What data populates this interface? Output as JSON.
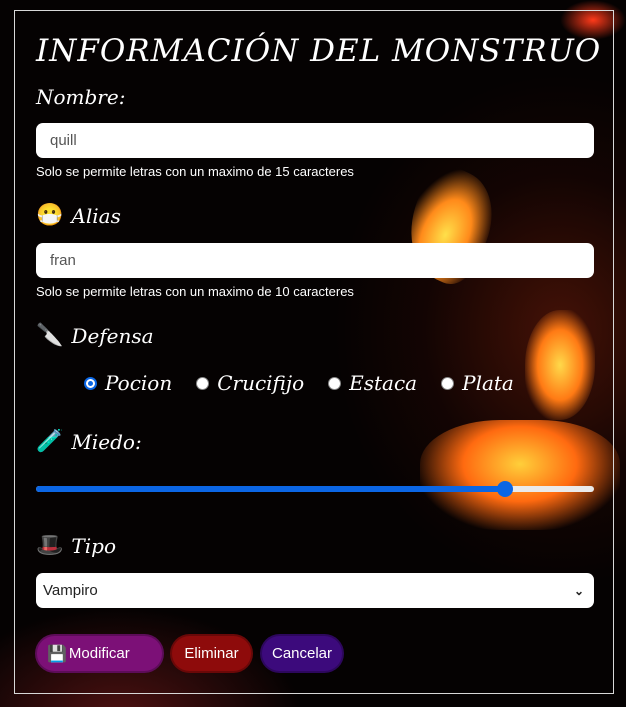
{
  "form": {
    "title": "Información del monstruo",
    "nombre": {
      "label": "Nombre:",
      "value": "quill",
      "hint": "Solo se permite letras con un maximo de 15 caracteres"
    },
    "alias": {
      "icon": "hockey-mask-icon",
      "icon_glyph": "🥽",
      "label": "Alias",
      "value": "fran",
      "hint": "Solo se permite letras con un maximo de 10 caracteres"
    },
    "defensa": {
      "icon": "cleaver-icon",
      "icon_glyph": "🔪",
      "label": "Defensa",
      "options": [
        {
          "label": "Pocion",
          "checked": true
        },
        {
          "label": "Crucifijo",
          "checked": false
        },
        {
          "label": "Estaca",
          "checked": false
        },
        {
          "label": "Plata",
          "checked": false
        }
      ]
    },
    "miedo": {
      "icon": "potion-icon",
      "icon_glyph": "🧪",
      "label": "Miedo:",
      "level": 0.84
    },
    "tipo": {
      "icon": "witch-hat-icon",
      "icon_glyph": "🧙",
      "label": "Tipo",
      "selected": "Vampiro"
    },
    "buttons": {
      "modificar": {
        "icon": "floppy-disk-icon",
        "label": "Modificar"
      },
      "eliminar": "Eliminar",
      "cancelar": "Cancelar"
    }
  },
  "colors": {
    "accent": "#0b66e4",
    "modificar_bg": "#7c1077",
    "eliminar_bg": "#8e0b0b",
    "cancelar_bg": "#3c0a7c"
  }
}
